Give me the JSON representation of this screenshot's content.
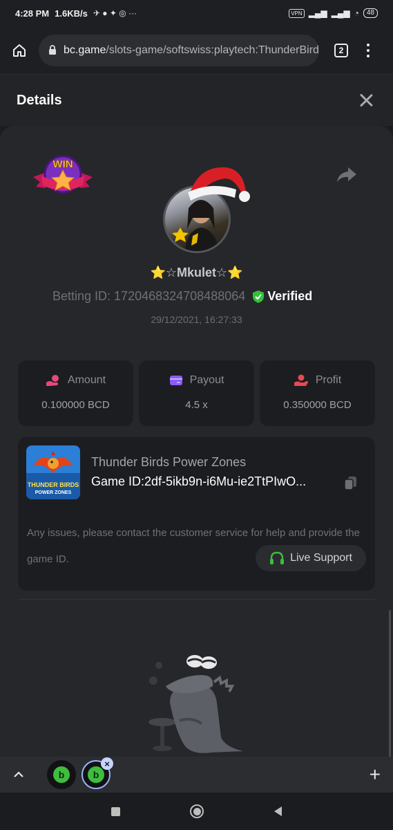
{
  "status_bar": {
    "time": "4:28 PM",
    "net_speed": "1.6KB/s",
    "vpn": "VPN",
    "battery": "48"
  },
  "browser": {
    "url_host": "bc.game",
    "url_path": "/slots-game/softswiss:playtech:ThunderBirds",
    "tab_count": "2"
  },
  "details": {
    "title": "Details"
  },
  "player": {
    "username": "⭐☆Mkulet☆⭐",
    "betting_id_label": "Betting ID: 1720468324708488064",
    "verified_label": "Verified",
    "timestamp": "29/12/2021, 16:27:33",
    "badge_text": "WIN"
  },
  "stats": [
    {
      "label": "Amount",
      "value": "0.100000 BCD",
      "icon": "amount-icon",
      "color": "#e8487a"
    },
    {
      "label": "Payout",
      "value": "4.5 x",
      "icon": "payout-icon",
      "color": "#8a5cf5"
    },
    {
      "label": "Profit",
      "value": "0.350000 BCD",
      "icon": "profit-icon",
      "color": "#e84855"
    }
  ],
  "game": {
    "name": "Thunder Birds Power Zones",
    "game_id": "Game ID:2df-5ikb9n-i6Mu-ie2TtPIwO...",
    "thumb_line1": "THUNDER BIRDS",
    "thumb_line2": "POWER ZONES",
    "notice": "Any issues, please contact the customer service for help and provide the game ID.",
    "support_label": "Live Support"
  },
  "tabs": [
    {
      "icon": "bc-logo-icon",
      "glyph": "b"
    },
    {
      "icon": "bc-logo-icon",
      "glyph": "b"
    }
  ],
  "colors": {
    "accent_green": "#3fbd3f",
    "verified_green": "#33c13a"
  }
}
